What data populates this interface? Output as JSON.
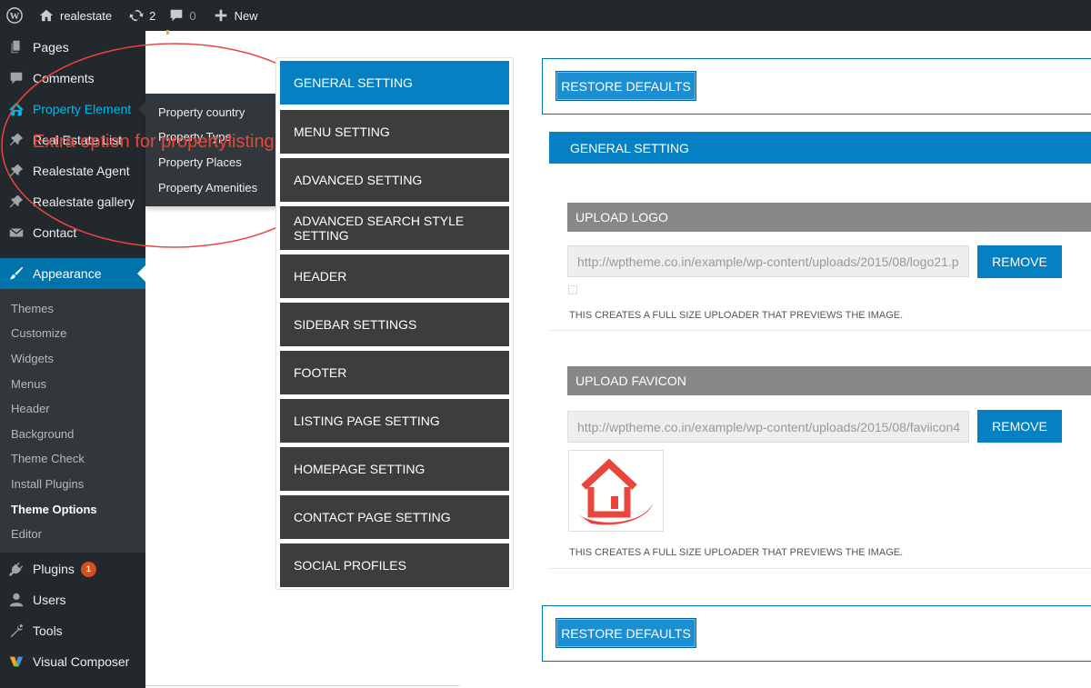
{
  "adminbar": {
    "site_name": "realestate",
    "updates_count": "2",
    "comments_count": "0",
    "new_label": "New"
  },
  "sidebar": {
    "top_items": [
      {
        "label": "Pages",
        "icon": "pages-icon"
      },
      {
        "label": "Comments",
        "icon": "comments-icon"
      },
      {
        "label": "Property Element",
        "icon": "home-icon"
      },
      {
        "label": "Real Estate List",
        "icon": "pin-icon"
      },
      {
        "label": "Realestate Agent",
        "icon": "pin-icon"
      },
      {
        "label": "Realestate gallery",
        "icon": "pin-icon"
      },
      {
        "label": "Contact",
        "icon": "mail-icon"
      }
    ],
    "appearance_label": "Appearance",
    "submenu": [
      "Themes",
      "Customize",
      "Widgets",
      "Menus",
      "Header",
      "Background",
      "Theme Check",
      "Install Plugins",
      "Theme Options",
      "Editor"
    ],
    "bottom_items": [
      {
        "label": "Plugins",
        "icon": "plugins-icon"
      },
      {
        "label": "Users",
        "icon": "users-icon"
      },
      {
        "label": "Tools",
        "icon": "tools-icon"
      },
      {
        "label": "Visual Composer",
        "icon": "visual-composer-icon"
      }
    ],
    "plugins_badge": "1"
  },
  "flyout": {
    "items": [
      "Property country",
      "Property Type",
      "Property Places",
      "Property Amenities"
    ]
  },
  "annotation": {
    "text": "Extra option for propertylisting",
    "color": "#e8453c"
  },
  "theme_nav": {
    "items": [
      "GENERAL SETTING",
      "MENU SETTING",
      "ADVANCED SETTING",
      "ADVANCED SEARCH STYLE SETTING",
      "HEADER",
      "SIDEBAR SETTINGS",
      "FOOTER",
      "LISTING PAGE SETTING",
      "HOMEPAGE SETTING",
      "CONTACT PAGE SETTING",
      "SOCIAL PROFILES"
    ]
  },
  "content": {
    "restore_label": "RESTORE DEFAULTS",
    "section_title": "GENERAL SETTING",
    "logo": {
      "header": "UPLOAD LOGO",
      "url": "http://wptheme.co.in/example/wp-content/uploads/2015/08/logo21.p",
      "remove_label": "REMOVE",
      "description": "THIS CREATES A FULL SIZE UPLOADER THAT PREVIEWS THE IMAGE."
    },
    "favicon": {
      "header": "UPLOAD FAVICON",
      "url": "http://wptheme.co.in/example/wp-content/uploads/2015/08/faviicon4",
      "remove_label": "REMOVE",
      "description": "THIS CREATES A FULL SIZE UPLOADER THAT PREVIEWS THE IMAGE."
    }
  },
  "colors": {
    "admin_dark": "#23282d",
    "wp_blue": "#0073aa",
    "theme_blue": "#0580c2",
    "nav_dark": "#3d3d3d"
  }
}
